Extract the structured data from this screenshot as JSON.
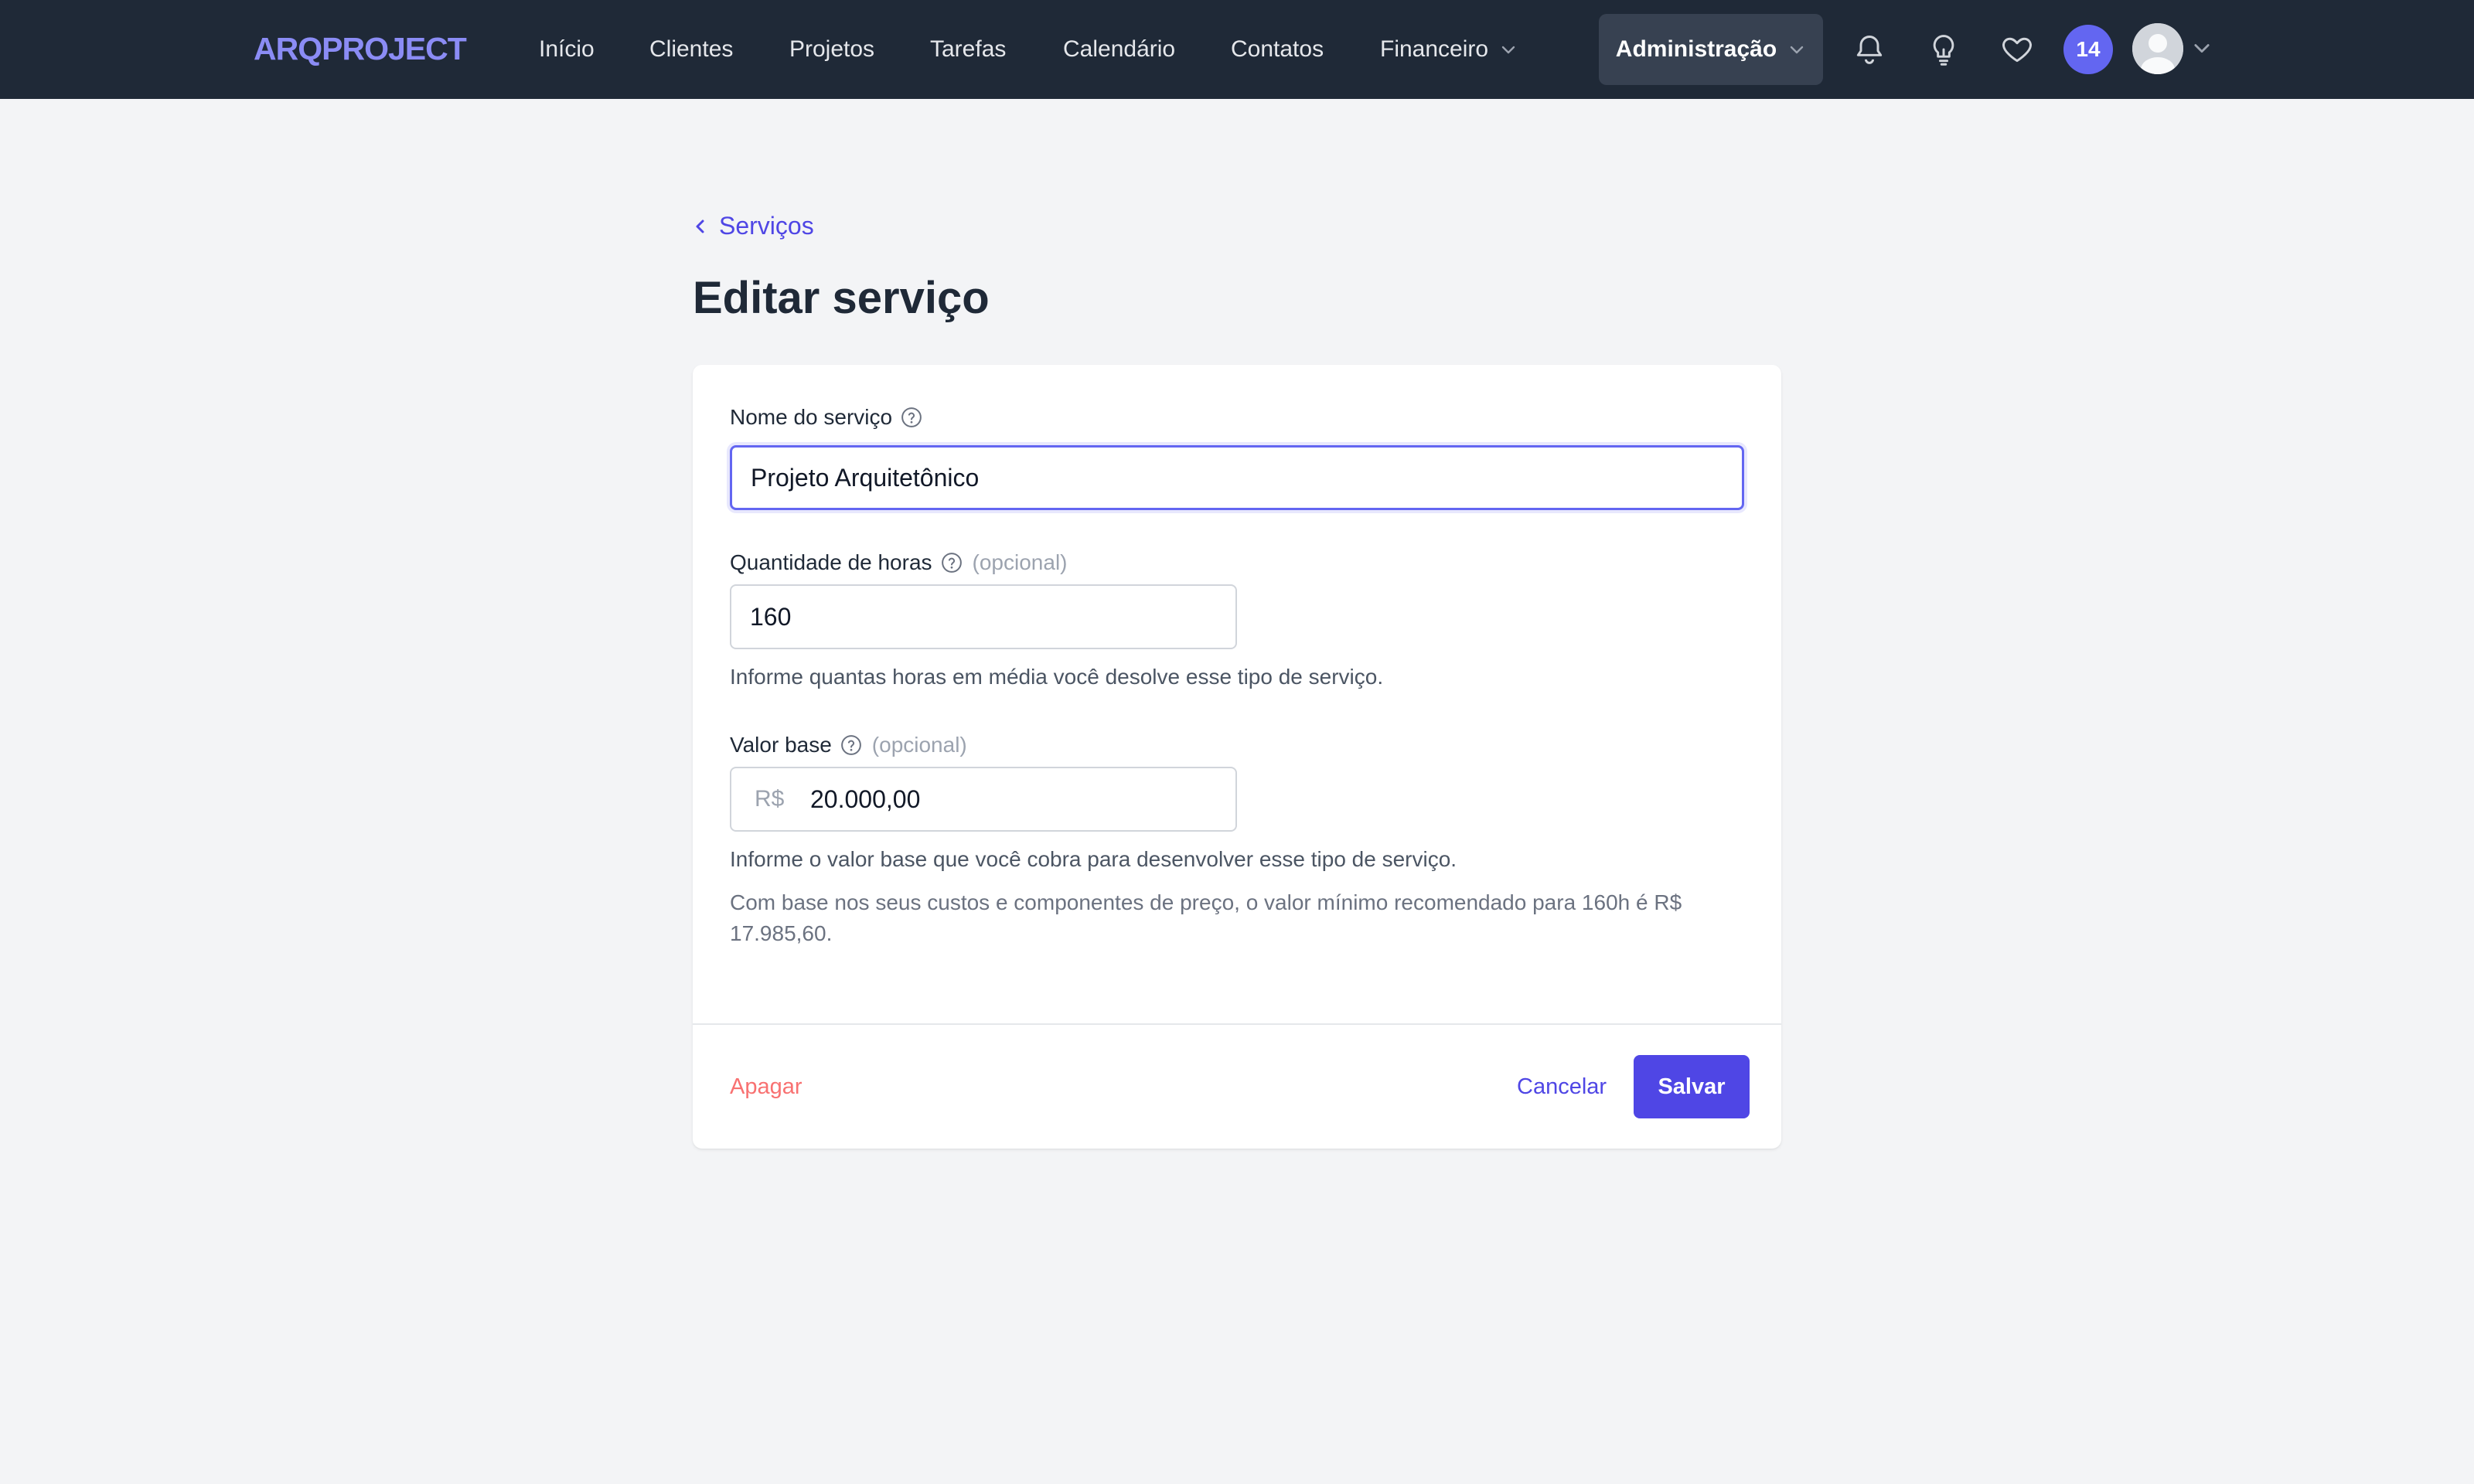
{
  "brand": {
    "logo_text": "ARQPROJECT",
    "accent": "#6366f1"
  },
  "nav": {
    "items": [
      {
        "label": "Início"
      },
      {
        "label": "Clientes"
      },
      {
        "label": "Projetos"
      },
      {
        "label": "Tarefas"
      },
      {
        "label": "Calendário"
      },
      {
        "label": "Contatos"
      },
      {
        "label": "Financeiro",
        "has_dropdown": true
      }
    ],
    "admin_label": "Administração",
    "icons": [
      "bell-icon",
      "lightbulb-icon",
      "heart-icon"
    ],
    "notification_count": "14",
    "avatar_icon": "user-avatar-icon"
  },
  "breadcrumb": {
    "label": "Serviços"
  },
  "page": {
    "title": "Editar serviço"
  },
  "form": {
    "service_name": {
      "label": "Nome do serviço",
      "value": "Projeto Arquitetônico"
    },
    "hours": {
      "label": "Quantidade de horas",
      "optional": "(opcional)",
      "value": "160",
      "hint": "Informe quantas horas em média você desolve esse tipo de serviço."
    },
    "base_value": {
      "label": "Valor base",
      "optional": "(opcional)",
      "currency": "R$",
      "value": "20.000,00",
      "hint": "Informe o valor base que você cobra para desenvolver esse tipo de serviço.",
      "recommendation": "Com base nos seus custos e componentes de preço, o valor mínimo recomendado para 160h é R$ 17.985,60."
    }
  },
  "actions": {
    "delete_label": "Apagar",
    "cancel_label": "Cancelar",
    "save_label": "Salvar"
  },
  "colors": {
    "nav_bg": "#1f2937",
    "page_bg": "#f3f4f6",
    "primary": "#4f46e5",
    "danger": "#f87171"
  }
}
